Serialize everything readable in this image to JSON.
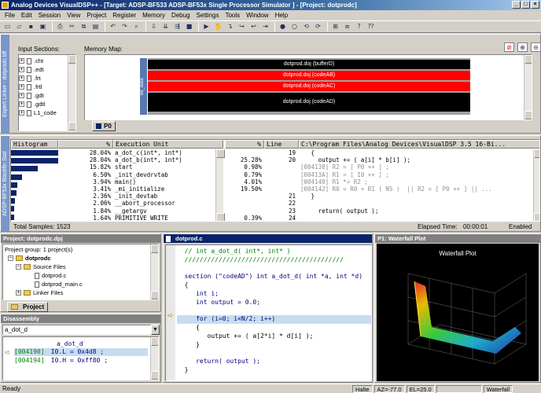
{
  "window": {
    "title": "Analog Devices VisualDSP++ - [Target: ADSP-BF533 ADSP-BF53x Single Processor Simulator ] - [Project: dotprodc]"
  },
  "menu": [
    "File",
    "Edit",
    "Session",
    "View",
    "Project",
    "Register",
    "Memory",
    "Debug",
    "Settings",
    "Tools",
    "Window",
    "Help"
  ],
  "expert_linker": {
    "side_title": "Expert Linker - dotprodc.ldf",
    "input_sections_label": "Input Sections:",
    "input_sections": [
      ".cht",
      ".edt",
      ".frt",
      ".frtl",
      ".gdt",
      ".gdtl",
      "L1_code"
    ],
    "memory_map_label": "Memory Map:",
    "mem_tag": "ed_data",
    "segments": [
      {
        "label": "dotprod.doj (bufferD)",
        "color": "#000000"
      },
      {
        "label": "dotprod.doj (codeAB)",
        "color": "#ff0000"
      },
      {
        "label": "dotprod.doj (codeAC)",
        "color": "#ff0000"
      },
      {
        "label": "dotprod.doj (codeAD)",
        "color": "#000000"
      }
    ],
    "tab_p0": "P0"
  },
  "profile": {
    "side_title": "ADSP-BF53x Blackfin Stat",
    "headers": {
      "histogram": "Histogram",
      "pct": "%",
      "exec_unit": "Execution Unit",
      "pct2": "%",
      "line": "Line",
      "source": "C:\\Program Files\\Analog Devices\\VisualDSP 3.5 16-Bi..."
    },
    "rows": [
      {
        "pct": "28.04%",
        "unit": "a_dot_c(int*, int*)",
        "bar": 1.0
      },
      {
        "pct": "28.04%",
        "unit": "a_dot_b(int*, int*)",
        "bar": 1.0
      },
      {
        "pct": "15.82%",
        "unit": "start",
        "bar": 0.56
      },
      {
        "pct": "6.50%",
        "unit": "_init_devdrvtab",
        "bar": 0.23
      },
      {
        "pct": "3.94%",
        "unit": "main()",
        "bar": 0.14
      },
      {
        "pct": "3.41%",
        "unit": "_mi_initialize",
        "bar": 0.12
      },
      {
        "pct": "2.36%",
        "unit": "_init_devtab",
        "bar": 0.08
      },
      {
        "pct": "2.06%",
        "unit": "__abort_processor",
        "bar": 0.07
      },
      {
        "pct": "1.84%",
        "unit": "__getargv",
        "bar": 0.06
      },
      {
        "pct": "1.64%",
        "unit": "PRIMITIVE_WRITE",
        "bar": 0.05
      }
    ],
    "src_rows": [
      {
        "pct": "",
        "line": "19",
        "text": "   {",
        "asm": false
      },
      {
        "pct": "25.28%",
        "line": "20",
        "text": "     output += ( a[i] * b[i] );",
        "asm": false
      },
      {
        "pct": "0.98%",
        "line": "",
        "text": "[004138] R2 = [ P0 ++ ] ;",
        "asm": true
      },
      {
        "pct": "0.79%",
        "line": "",
        "text": "[00413A] R1 = [ I0 ++ ] ;",
        "asm": true
      },
      {
        "pct": "4.01%",
        "line": "",
        "text": "[004140] R1 *= R2 ;",
        "asm": true
      },
      {
        "pct": "19.50%",
        "line": "",
        "text": "[004142] R0 = R0 + R1 ( NS )  || R2 = [ P0 ++ ] || ...",
        "asm": true
      },
      {
        "pct": "",
        "line": "21",
        "text": "   }",
        "asm": false
      },
      {
        "pct": "",
        "line": "22",
        "text": "",
        "asm": false
      },
      {
        "pct": "",
        "line": "23",
        "text": "     return( output );",
        "asm": false
      },
      {
        "pct": "0.39%",
        "line": "24",
        "text": "",
        "asm": false
      }
    ],
    "total_samples": "Total Samples: 1523",
    "elapsed": "Elapsed Time:",
    "elapsed_value": "00:00:01",
    "state": "Enabled"
  },
  "project": {
    "title": "Project: dotprodc.dpj",
    "group": "Project group: 1 project(s)",
    "name": "dotprodc",
    "source_files": "Source Files",
    "files": [
      "dotprod.c",
      "dotprod_main.c"
    ],
    "linker_files": "Linker Files",
    "tab": "Project"
  },
  "disassembly": {
    "title": "Disassembly",
    "combo": "a_dot_d",
    "func_label": "a_dot_d",
    "lines": [
      {
        "addr": "[004190]",
        "instr": "I0.L = 0x4d8 ;",
        "current": true
      },
      {
        "addr": "[004194]",
        "instr": "I0.H = 0xff80 ;",
        "current": false
      }
    ]
  },
  "editor": {
    "title": "dotprod.c",
    "lines": [
      {
        "text": "  // int a_dot_d( int*, int* )",
        "kind": "comment"
      },
      {
        "text": "  //////////////////////////////////////////",
        "kind": "comment"
      },
      {
        "text": "",
        "kind": "plain"
      },
      {
        "text": "  section (\"codeAD\") int a_dot_d( int *a, int *d)",
        "kind": "code"
      },
      {
        "text": "  {",
        "kind": "plain"
      },
      {
        "text": "     int i;",
        "kind": "code"
      },
      {
        "text": "     int output = 0.0;",
        "kind": "code"
      },
      {
        "text": "",
        "kind": "plain"
      },
      {
        "text": "     for (i=0; i<N/2; i++)",
        "kind": "current"
      },
      {
        "text": "     {",
        "kind": "plain"
      },
      {
        "text": "        output += ( a[2*i] * d[i] );",
        "kind": "plain"
      },
      {
        "text": "     }",
        "kind": "plain"
      },
      {
        "text": "",
        "kind": "plain"
      },
      {
        "text": "     return( output );",
        "kind": "code"
      },
      {
        "text": "  }",
        "kind": "plain"
      }
    ]
  },
  "plot": {
    "window_title": "P1: Waterfall Plot",
    "title": "Waterfall Plot",
    "az": "AZ=-77.0",
    "el": "EL=25.0",
    "mode": "Waterfall"
  },
  "status": {
    "ready": "Ready",
    "halted": "Halte"
  },
  "colors": {
    "accent": "#0a246a",
    "segment_red": "#ff0000",
    "highlight": "#c8dcf0"
  }
}
